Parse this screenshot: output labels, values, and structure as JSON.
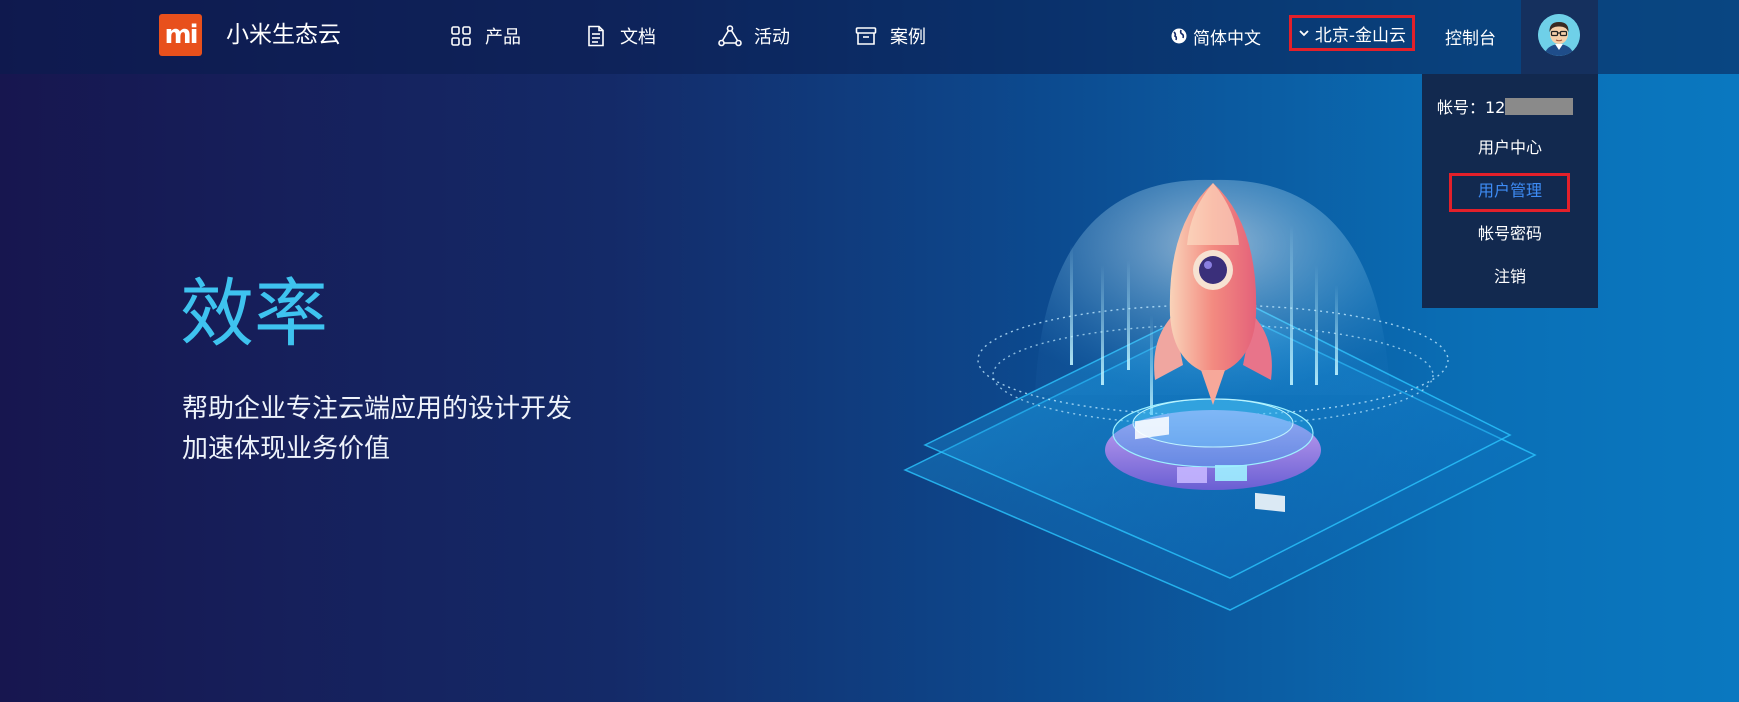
{
  "header": {
    "logo_text": "mi",
    "brand": "小米生态云",
    "nav": [
      {
        "label": "产品",
        "icon": "grid-icon"
      },
      {
        "label": "文档",
        "icon": "document-icon"
      },
      {
        "label": "活动",
        "icon": "triangle-icon"
      },
      {
        "label": "案例",
        "icon": "archive-icon"
      }
    ],
    "language": "简体中文",
    "region": "北京-金山云",
    "console": "控制台"
  },
  "dropdown": {
    "account_label": "帐号：12",
    "items": [
      "用户中心",
      "用户管理",
      "帐号密码",
      "注销"
    ],
    "active_item": "用户管理"
  },
  "hero": {
    "title": "效率",
    "subtitle_line1": "帮助企业专注云端应用的设计开发",
    "subtitle_line2": "加速体现业务价值"
  },
  "colors": {
    "accent": "#3ec3ef",
    "logo": "#e8501c",
    "highlight_border": "#e3202a",
    "active_link": "#3e8cf5"
  }
}
